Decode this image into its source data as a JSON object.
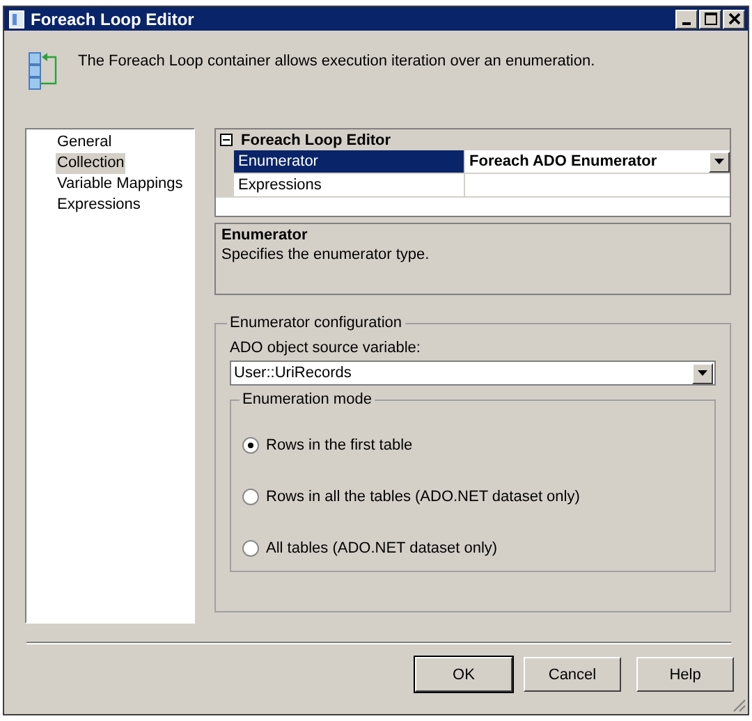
{
  "window": {
    "title": "Foreach Loop Editor"
  },
  "header": {
    "description": "The Foreach Loop container allows execution iteration over an enumeration."
  },
  "sidebar": {
    "items": [
      {
        "label": "General",
        "selected": false
      },
      {
        "label": "Collection",
        "selected": true
      },
      {
        "label": "Variable Mappings",
        "selected": false
      },
      {
        "label": "Expressions",
        "selected": false
      }
    ]
  },
  "property_grid": {
    "category": "Foreach Loop Editor",
    "expanded": true,
    "rows": [
      {
        "name": "Enumerator",
        "value": "Foreach ADO Enumerator",
        "selected": true,
        "kind": "dropdown"
      },
      {
        "name": "Expressions",
        "value": "",
        "selected": false,
        "kind": "text"
      }
    ]
  },
  "description_box": {
    "title": "Enumerator",
    "text": "Specifies the enumerator type."
  },
  "enumerator_configuration": {
    "title": "Enumerator configuration",
    "source_label": "ADO object source variable:",
    "source_value": "User::UriRecords",
    "mode": {
      "title": "Enumeration mode",
      "options": [
        {
          "label": "Rows in the first table",
          "selected": true
        },
        {
          "label": "Rows in all the tables (ADO.NET dataset only)",
          "selected": false
        },
        {
          "label": "All tables (ADO.NET dataset only)",
          "selected": false
        }
      ]
    }
  },
  "buttons": [
    {
      "label": "OK",
      "default": true
    },
    {
      "label": "Cancel",
      "default": false
    },
    {
      "label": "Help",
      "default": false
    }
  ]
}
